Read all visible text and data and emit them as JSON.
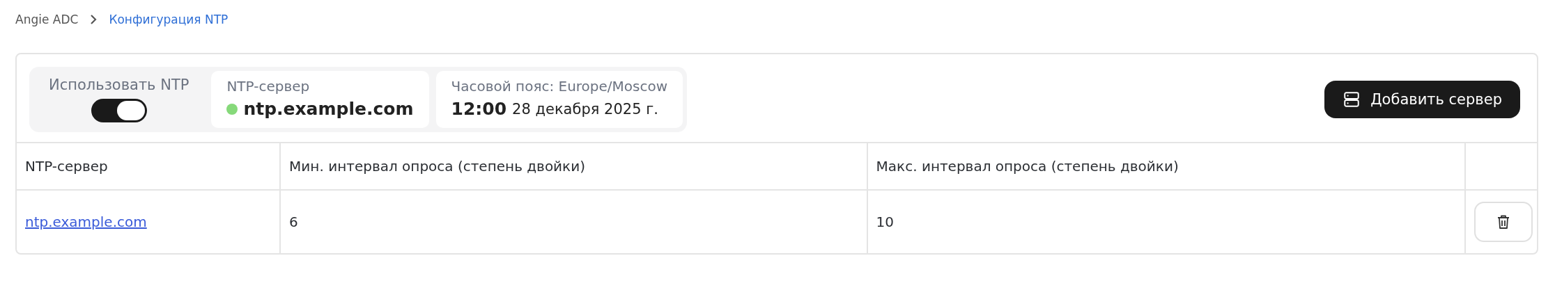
{
  "breadcrumb": [
    {
      "label": "Angie ADC",
      "current": false
    },
    {
      "label": "Конфигурация NTP",
      "current": true
    }
  ],
  "summary": {
    "use_ntp": {
      "label": "Использовать NTP",
      "on": true
    },
    "server": {
      "label": "NTP-сервер",
      "online": true,
      "value": "ntp.example.com"
    },
    "timezone": {
      "label": "Часовой пояс: Europe/Moscow",
      "time": "12:00",
      "date": "28 декабря 2025 г."
    }
  },
  "add_button": "Добавить сервер",
  "table": {
    "columns": [
      "NTP-сервер",
      "Мин. интервал опроса (степень двойки)",
      "Макс. интервал опроса (степень двойки)"
    ],
    "rows": [
      {
        "server": "ntp.example.com",
        "min": "6",
        "max": "10"
      }
    ]
  }
}
